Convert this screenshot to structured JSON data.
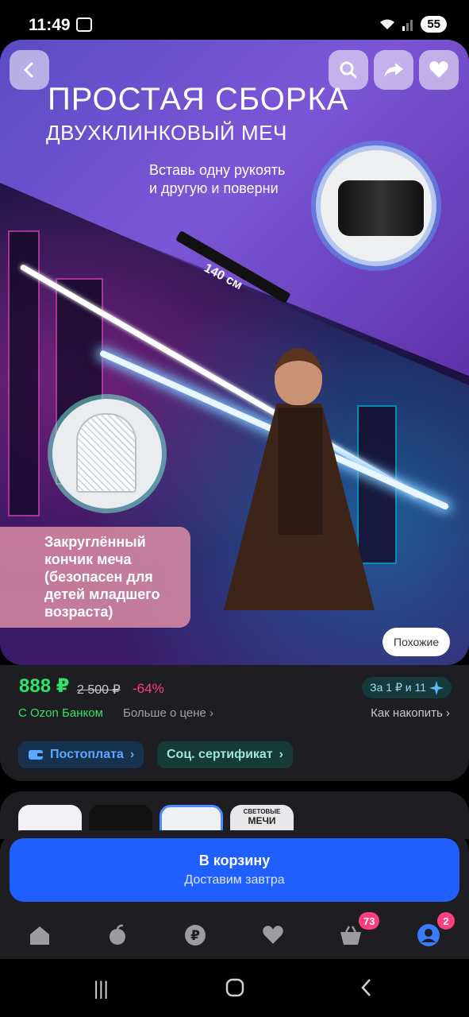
{
  "status_bar": {
    "time": "11:49",
    "battery": "55"
  },
  "hero": {
    "title": "ПРОСТАЯ СБОРКА",
    "subtitle": "ДВУХКЛИНКОВЫЙ МЕЧ",
    "hint_line1": "Вставь одну рукоять",
    "hint_line2": "и другую и поверни",
    "length": "140 см",
    "tip_note_line1": "Закруглённый",
    "tip_note_line2": "кончик меча",
    "tip_note_line3": "(безопасен для",
    "tip_note_line4": "детей младшего",
    "tip_note_line5": "возраста)",
    "similar_label": "Похожие"
  },
  "price": {
    "current": "888 ₽",
    "old": "2 500 ₽",
    "discount": "-64%",
    "bonus": "За 1 ₽ и 11",
    "ozon_bank": "С Ozon Банком",
    "more_price": "Больше о цене",
    "how_to_save": "Как накопить"
  },
  "chips": {
    "postpay": "Постоплата",
    "social": "Соц. сертификат"
  },
  "thumb_text": {
    "t4_line1": "СВЕТОВЫЕ",
    "t4_line2": "МЕЧИ"
  },
  "cart": {
    "label": "В корзину",
    "delivery": "Доставим завтра"
  },
  "tabbar": {
    "cart_badge": "73",
    "profile_badge": "2"
  },
  "colors": {
    "accent": "#1f5fff",
    "price": "#2ee46a",
    "discount": "#ff3f7d"
  }
}
